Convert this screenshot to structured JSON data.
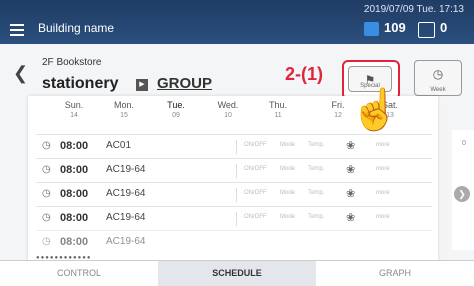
{
  "header": {
    "title": "Building name",
    "datetime": "2019/07/09 Tue. 17:13",
    "power_count": "109",
    "alert_count": "0"
  },
  "nav": {
    "floor": "2F Bookstore",
    "category": "stationery",
    "group": "GROUP"
  },
  "annotation": "2-(1)",
  "buttons": {
    "special": "Special",
    "week": "Week"
  },
  "days": [
    {
      "name": "Sun.",
      "num": "14"
    },
    {
      "name": "Mon.",
      "num": "15"
    },
    {
      "name": "Tue.",
      "num": "09"
    },
    {
      "name": "Wed.",
      "num": "10"
    },
    {
      "name": "Thu.",
      "num": "11"
    },
    {
      "name": "Fri.",
      "num": "12"
    },
    {
      "name": "Sat.",
      "num": "13"
    }
  ],
  "schedule": [
    {
      "time": "08:00",
      "unit": "AC01"
    },
    {
      "time": "08:00",
      "unit": "AC19-64"
    },
    {
      "time": "08:00",
      "unit": "AC19-64"
    },
    {
      "time": "08:00",
      "unit": "AC19-64"
    },
    {
      "time": "08:00",
      "unit": "AC19-64"
    }
  ],
  "cols": {
    "onoff": "ON/OFF",
    "mode": "Mode",
    "temp": "Temp.",
    "more": "more"
  },
  "tabs": {
    "control": "CONTROL",
    "schedule": "SCHEDULE",
    "graph": "GRAPH"
  },
  "side_marker": "0",
  "colors": {
    "header": "#2b4f7e",
    "accent": "#e0243a",
    "power": "#3a8de0"
  }
}
